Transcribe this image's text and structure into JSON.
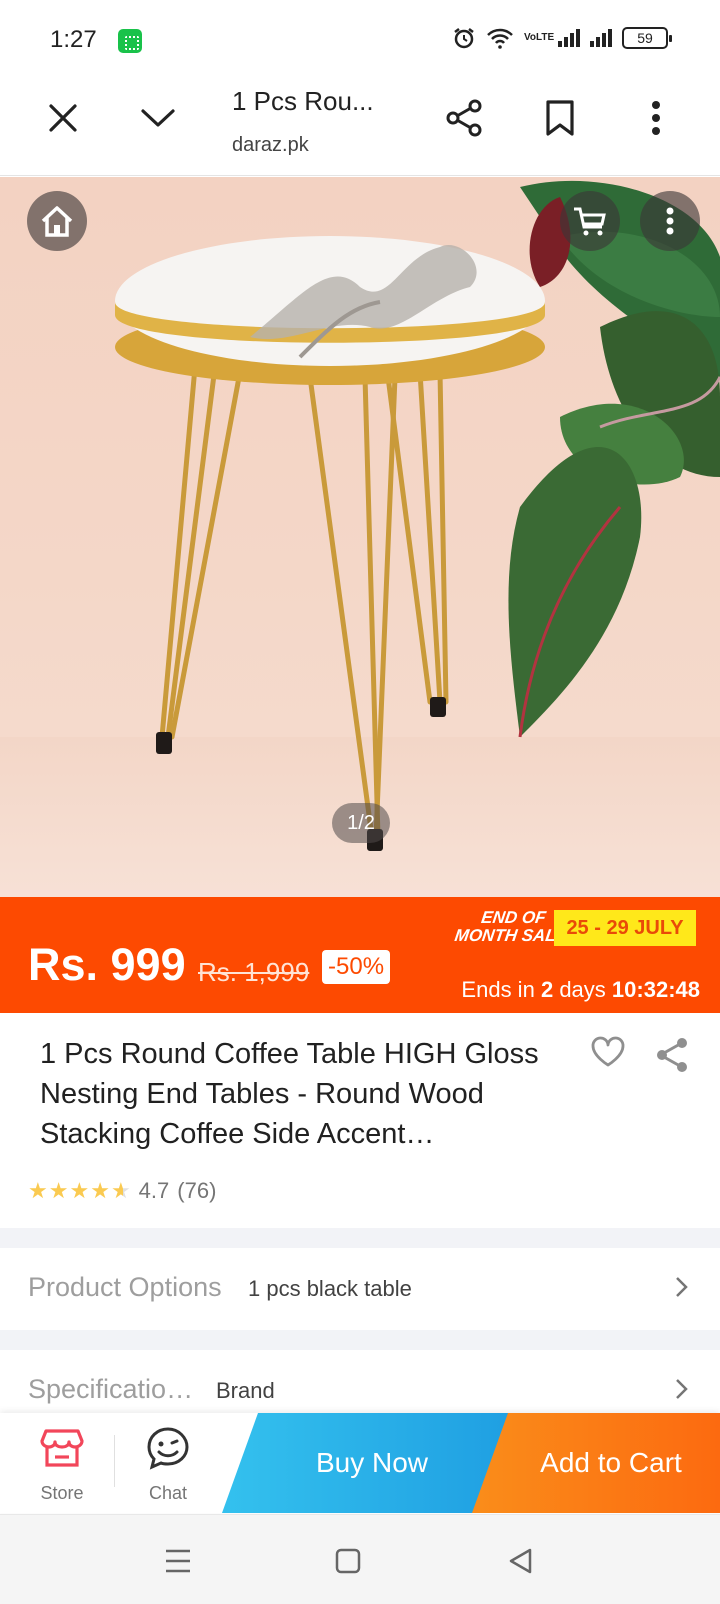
{
  "status_bar": {
    "time": "1:27",
    "network_label": "VoLTE",
    "battery": "59"
  },
  "browser": {
    "title": "1 Pcs Rou...",
    "url": "daraz.pk"
  },
  "gallery": {
    "pager": "1/2"
  },
  "price": {
    "current": "Rs. 999",
    "original": "Rs. 1,999",
    "discount": "-50%",
    "campaign_line1": "END OF",
    "campaign_line2": "MONTH SALE",
    "campaign_dates": "25 - 29 JULY",
    "ends_prefix": "Ends in",
    "ends_days": "2",
    "ends_days_label": "days",
    "ends_time": "10:32:48"
  },
  "product": {
    "title": "1 Pcs Round Coffee Table HIGH Gloss Nesting End Tables - Round Wood Stacking Coffee Side Accent…",
    "rating": "4.7",
    "reviews": "(76)",
    "stars": 4.7
  },
  "options": {
    "label": "Product Options",
    "value": "1 pcs black table"
  },
  "specifications": {
    "label": "Specificatio…",
    "value": "Brand"
  },
  "actions": {
    "store": "Store",
    "chat": "Chat",
    "buy_now": "Buy Now",
    "add_to_cart": "Add to Cart"
  },
  "colors": {
    "brand_orange": "#fd4a01",
    "buy_now": "#1f9fe2",
    "add_to_cart": "#fc6a10",
    "star": "#faca51",
    "store_icon": "#f2465a"
  }
}
